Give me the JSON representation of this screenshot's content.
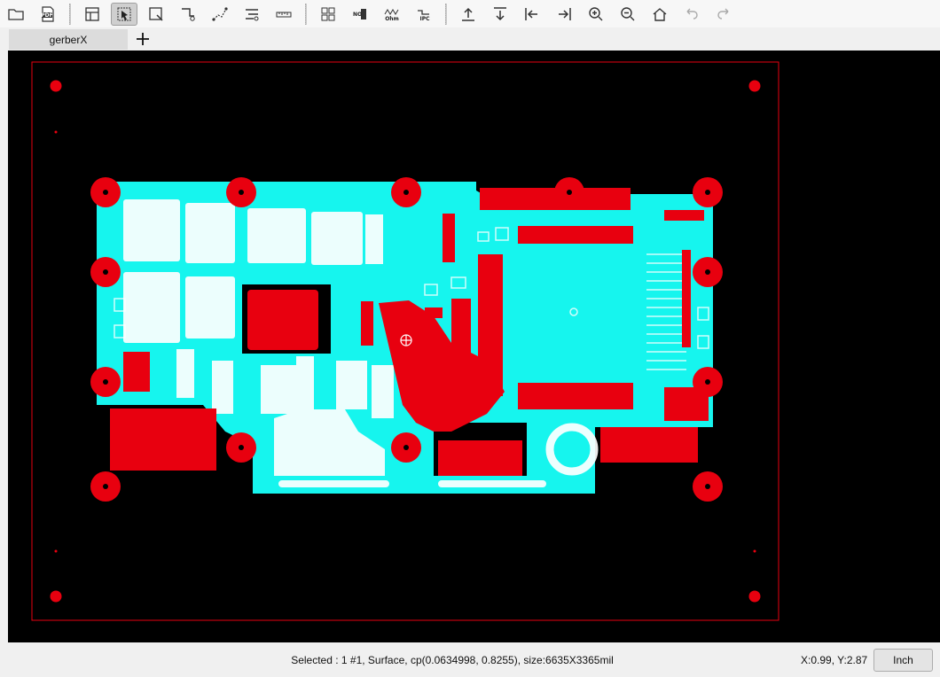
{
  "toolbar": {
    "buttons": [
      {
        "name": "open-folder-icon"
      },
      {
        "name": "pdf-icon",
        "text": "PDF"
      },
      {
        "name": "layout-icon"
      },
      {
        "name": "select-pointer-icon",
        "active": true
      },
      {
        "name": "zoom-window-icon"
      },
      {
        "name": "route-icon"
      },
      {
        "name": "connect-icon"
      },
      {
        "name": "layers-icon"
      },
      {
        "name": "ruler-icon"
      },
      {
        "name": "grid-compare-icon"
      },
      {
        "name": "no-net-icon",
        "text": "NO"
      },
      {
        "name": "ohm-icon",
        "text": "Ohm"
      },
      {
        "name": "ipc-icon",
        "text": "IPC"
      },
      {
        "name": "move-top-icon"
      },
      {
        "name": "move-bottom-icon"
      },
      {
        "name": "move-left-icon"
      },
      {
        "name": "move-right-icon"
      },
      {
        "name": "zoom-in-icon"
      },
      {
        "name": "zoom-out-icon"
      },
      {
        "name": "home-icon"
      },
      {
        "name": "undo-icon"
      },
      {
        "name": "redo-icon"
      }
    ]
  },
  "tabs": {
    "items": [
      {
        "label": "gerberX"
      }
    ],
    "add_label": "+"
  },
  "canvas": {
    "colors": {
      "background": "#000000",
      "copper": "#e8000f",
      "board": "#16f5ee",
      "silk": "#ffffff"
    }
  },
  "status": {
    "selection": "Selected : 1  #1, Surface, cp(0.0634998, 0.8255), size:6635X3365mil",
    "coords": "X:0.99, Y:2.87",
    "unit": "Inch"
  }
}
